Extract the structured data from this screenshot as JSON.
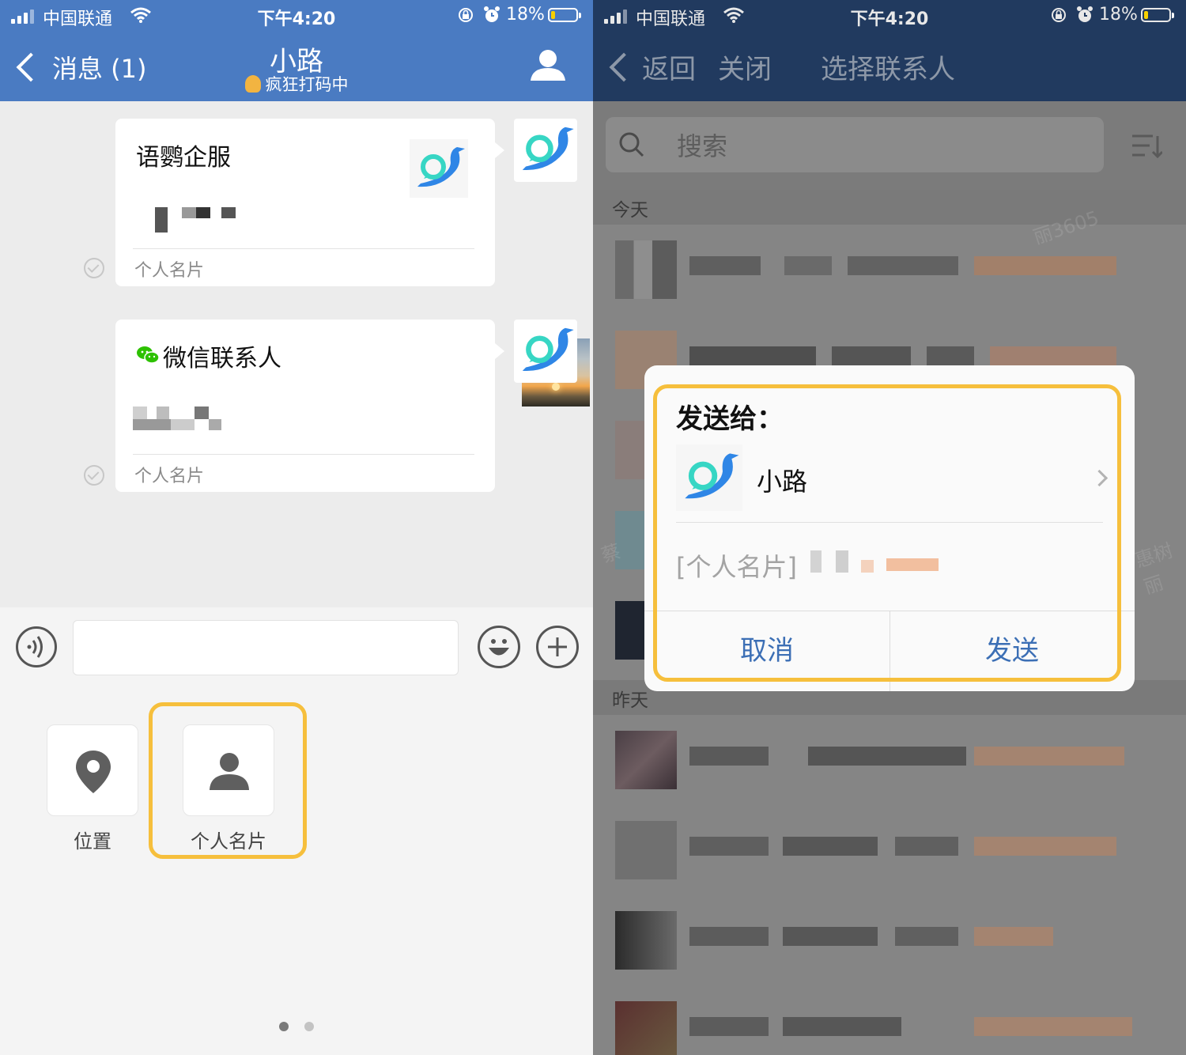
{
  "status_bar": {
    "carrier": "中国联通",
    "time": "下午4:20",
    "battery": "18%",
    "battery_level": 0.18
  },
  "left": {
    "nav": {
      "back_label": "消息 (1)",
      "title": "小路",
      "subtitle": "疯狂打码中"
    },
    "messages": [
      {
        "title": "语鹦企服",
        "footer": "个人名片"
      },
      {
        "title": "微信联系人",
        "footer": "个人名片"
      }
    ],
    "tools": [
      {
        "label": "位置",
        "icon": "location-pin-icon"
      },
      {
        "label": "个人名片",
        "icon": "person-icon"
      }
    ],
    "page_indicator": {
      "count": 2,
      "active": 0
    },
    "highlight_color": "#f6bf3c"
  },
  "right": {
    "nav": {
      "back_label": "返回",
      "close_label": "关闭",
      "title": "选择联系人"
    },
    "search": {
      "placeholder": "搜索"
    },
    "sections": {
      "today": "今天",
      "yesterday": "昨天"
    },
    "watermarks": [
      "丽3605",
      "蔡",
      "惠树丽"
    ],
    "dialog": {
      "title": "发送给：",
      "recipient": "小路",
      "message": "[个人名片]",
      "cancel_label": "取消",
      "send_label": "发送"
    }
  },
  "colors": {
    "left_nav": "#4a7bc2",
    "right_nav": "#213a5f",
    "accent_blue": "#3c6fb5",
    "highlight": "#f6bf3c"
  }
}
